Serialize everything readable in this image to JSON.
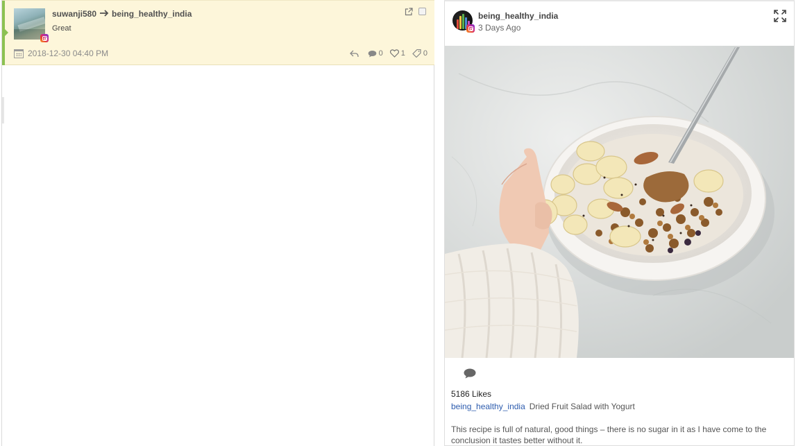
{
  "message": {
    "from_user": "suwanji580",
    "to_user": "being_healthy_india",
    "text": "Great",
    "timestamp": "2018-12-30 04:40 PM",
    "comments_count": "0",
    "likes_count": "1",
    "tags_count": "0",
    "avatar_icon": "instagram-icon",
    "accent_color": "#8cc152"
  },
  "post": {
    "username": "being_healthy_india",
    "time_ago": "3 Days Ago",
    "likes_label": "5186 Likes",
    "caption_user": "being_healthy_india",
    "caption_title": "Dried Fruit Salad with Yogurt",
    "caption_body": "This recipe is full of natural, good things – there is no sugar in it as I have come to the conclusion it tastes better without it.",
    "image_icon": "photo",
    "link_color": "#2d5cae"
  }
}
